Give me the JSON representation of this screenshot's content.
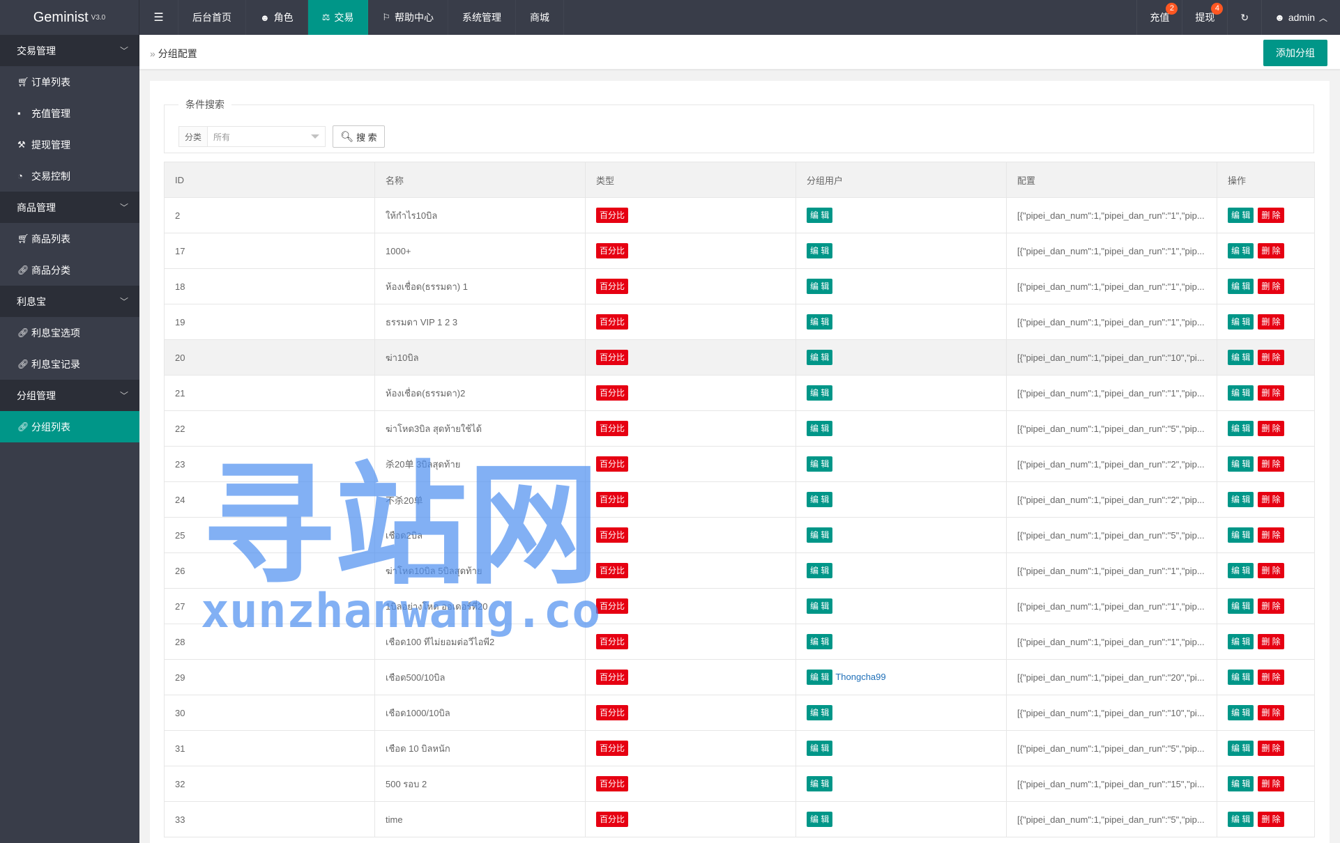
{
  "app": {
    "name": "Geminist",
    "version": "V3.0"
  },
  "topnav": {
    "toggle_icon": "menu-icon",
    "items": [
      {
        "label": "后台首页",
        "icon": ""
      },
      {
        "label": "角色",
        "icon": "user-icon"
      },
      {
        "label": "交易",
        "icon": "scale-icon",
        "active": true
      },
      {
        "label": "帮助中心",
        "icon": "flag-icon"
      },
      {
        "label": "系统管理",
        "icon": ""
      },
      {
        "label": "商城",
        "icon": ""
      }
    ],
    "right": {
      "recharge": {
        "label": "充值",
        "badge": "2"
      },
      "withdraw": {
        "label": "提现",
        "badge": "4"
      },
      "refresh_icon": "refresh-icon",
      "user": "admin"
    }
  },
  "sidebar": [
    {
      "group": "交易管理",
      "items": [
        {
          "label": "订单列表",
          "icon": "cart-icon"
        },
        {
          "label": "充值管理",
          "icon": "chat-icon"
        },
        {
          "label": "提现管理",
          "icon": "hammer-icon"
        },
        {
          "label": "交易控制",
          "icon": "gauge-icon"
        }
      ]
    },
    {
      "group": "商品管理",
      "items": [
        {
          "label": "商品列表",
          "icon": "cart-icon"
        },
        {
          "label": "商品分类",
          "icon": "link-icon"
        }
      ]
    },
    {
      "group": "利息宝",
      "items": [
        {
          "label": "利息宝选项",
          "icon": "link-icon"
        },
        {
          "label": "利息宝记录",
          "icon": "link-icon"
        }
      ]
    },
    {
      "group": "分组管理",
      "items": [
        {
          "label": "分组列表",
          "icon": "link-icon",
          "active": true
        }
      ]
    }
  ],
  "breadcrumb": {
    "current": "分组配置"
  },
  "add_button": "添加分组",
  "search": {
    "legend": "条件搜索",
    "filter_label": "分类",
    "filter_value": "所有",
    "button": "搜 索"
  },
  "table": {
    "columns": [
      "ID",
      "名称",
      "类型",
      "分组用户",
      "配置",
      "操作"
    ],
    "type_tag": "百分比",
    "edit_label": "编 辑",
    "delete_label": "删 除",
    "rows": [
      {
        "id": "2",
        "name": "ให้กำไร10บิล",
        "user": "",
        "config": "[{\"pipei_dan_num\":1,\"pipei_dan_run\":\"1\",\"pip..."
      },
      {
        "id": "17",
        "name": "1000+",
        "user": "",
        "config": "[{\"pipei_dan_num\":1,\"pipei_dan_run\":\"1\",\"pip..."
      },
      {
        "id": "18",
        "name": "ห้องเชื่อด(ธรรมดา) 1",
        "user": "",
        "config": "[{\"pipei_dan_num\":1,\"pipei_dan_run\":\"1\",\"pip..."
      },
      {
        "id": "19",
        "name": "ธรรมดา VIP 1 2 3",
        "user": "",
        "config": "[{\"pipei_dan_num\":1,\"pipei_dan_run\":\"1\",\"pip..."
      },
      {
        "id": "20",
        "name": "ฆ่า10บิล",
        "user": "",
        "config": "[{\"pipei_dan_num\":1,\"pipei_dan_run\":\"10\",\"pi...",
        "highlight": true
      },
      {
        "id": "21",
        "name": "ห้องเชื่อด(ธรรมดา)2",
        "user": "",
        "config": "[{\"pipei_dan_num\":1,\"pipei_dan_run\":\"1\",\"pip..."
      },
      {
        "id": "22",
        "name": "ฆ่าโหด3บิล สุดท้ายใช้ได้",
        "user": "",
        "config": "[{\"pipei_dan_num\":1,\"pipei_dan_run\":\"5\",\"pip..."
      },
      {
        "id": "23",
        "name": "杀20单 3บิลสุดท้าย",
        "user": "",
        "config": "[{\"pipei_dan_num\":1,\"pipei_dan_run\":\"2\",\"pip..."
      },
      {
        "id": "24",
        "name": "不杀20单",
        "user": "",
        "config": "[{\"pipei_dan_num\":1,\"pipei_dan_run\":\"2\",\"pip..."
      },
      {
        "id": "25",
        "name": "เชือด2บิล",
        "user": "",
        "config": "[{\"pipei_dan_num\":1,\"pipei_dan_run\":\"5\",\"pip..."
      },
      {
        "id": "26",
        "name": "ฆ่าโหด10บิล 5บิลสุดท้าย",
        "user": "",
        "config": "[{\"pipei_dan_num\":1,\"pipei_dan_run\":\"1\",\"pip..."
      },
      {
        "id": "27",
        "name": "1บิลอย่างโหด ออเดอร์ที่20",
        "user": "",
        "config": "[{\"pipei_dan_num\":1,\"pipei_dan_run\":\"1\",\"pip..."
      },
      {
        "id": "28",
        "name": "เชือด100 ทีไม่ยอมต่อวีไอพี2",
        "user": "",
        "config": "[{\"pipei_dan_num\":1,\"pipei_dan_run\":\"1\",\"pip..."
      },
      {
        "id": "29",
        "name": "เชือด500/10บิล",
        "user": "Thongcha99",
        "config": "[{\"pipei_dan_num\":1,\"pipei_dan_run\":\"20\",\"pi..."
      },
      {
        "id": "30",
        "name": "เชือด1000/10บิล",
        "user": "",
        "config": "[{\"pipei_dan_num\":1,\"pipei_dan_run\":\"10\",\"pi..."
      },
      {
        "id": "31",
        "name": "เชือด 10 บิลหนัก",
        "user": "",
        "config": "[{\"pipei_dan_num\":1,\"pipei_dan_run\":\"5\",\"pip..."
      },
      {
        "id": "32",
        "name": "500 รอบ 2",
        "user": "",
        "config": "[{\"pipei_dan_num\":1,\"pipei_dan_run\":\"15\",\"pi..."
      },
      {
        "id": "33",
        "name": "time",
        "user": "",
        "config": "[{\"pipei_dan_num\":1,\"pipei_dan_run\":\"5\",\"pip..."
      }
    ]
  },
  "watermark": {
    "cn": "寻站网",
    "en": "xunzhanwang.com"
  },
  "colors": {
    "topbar": "#393d49",
    "sidebar": "#393d49",
    "sidebar_group": "#2b2e37",
    "accent": "#009688",
    "danger": "#e60012"
  }
}
